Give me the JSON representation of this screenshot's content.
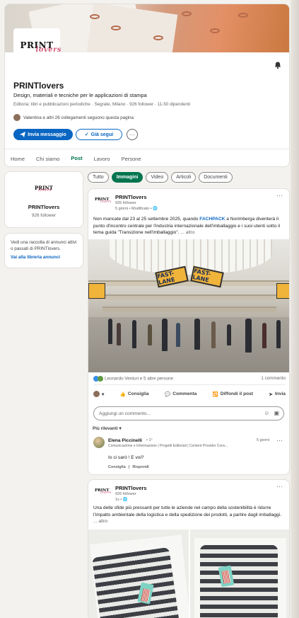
{
  "company": {
    "name": "PRINTlovers",
    "tagline": "Design, materiali e tecniche per le applicazioni di stampa",
    "meta": "Editoria: libri e pubblicazioni periodiche · Segrate, Milano · 926 follower · 11-50 dipendenti",
    "followers_note": "Valentina e altri 26 collegamenti seguono questa pagina",
    "logo_text": "PRINT",
    "logo_script": "lovers"
  },
  "buttons": {
    "message": "Invia messaggio",
    "following": "Già segui",
    "more": "···"
  },
  "tabs": [
    "Home",
    "Chi siamo",
    "Post",
    "Lavoro",
    "Persone"
  ],
  "active_tab": "Post",
  "left": {
    "name": "PRINTlovers",
    "followers": "926 follower",
    "ads_text": "Vedi una raccolta di annunci attivi o passati di PRINTlovers.",
    "ads_link": "Vai alla libreria annunci"
  },
  "filters": [
    "Tutto",
    "Immagini",
    "Video",
    "Articoli",
    "Documenti"
  ],
  "active_filter": "Immagini",
  "post1": {
    "author": "PRINTlovers",
    "followers": "926 follower",
    "time": "5 giorni • Modificato • ",
    "text_a": "Non mancate dal 23 al 25 settembre 2025, quando ",
    "text_highlight": "FACHPACK",
    "text_b": " a Norimberga diventerà il punto d'incontro centrale per l'industria internazionale dell'imballaggio e i suoi utenti sotto il tema guida \"Transizione nell'imballaggio\". ",
    "more": "... altro",
    "sign_left": "FAST-LANE",
    "sign_right": "FAST-LANE",
    "reactions": "Leonardo Venturi e 5 altre persone",
    "comments": "1 commento",
    "actions": [
      "Consiglia",
      "Commenta",
      "Diffondi il post",
      "Invia"
    ],
    "comment_placeholder": "Aggiungi un commento...",
    "sort": "Più rilevanti ▾",
    "comment": {
      "name": "Elena Piccinelli",
      "degree": "• 1°",
      "headline": "Comunicazione e Informazione | Progetti Editoriali | Content Provider Conv...",
      "time": "5 giorni",
      "text": "Io ci sarò ! E voi?",
      "like": "Consiglia",
      "sep": "|",
      "reply": "Rispondi"
    }
  },
  "post2": {
    "author": "PRINTlovers",
    "followers": "926 follower",
    "time": "1s • ",
    "text": "Una delle sfide più pressanti per tutte le aziende nel campo della sostenibilità è ridurre l'impatto ambientale della logistica e della spedizione dei prodotti, a partire dagli imballaggi. ",
    "more": "... altro"
  },
  "colors": {
    "brand_blue": "#0a66c2",
    "active_green": "#01754f",
    "logo_pink": "#d05a7a"
  }
}
